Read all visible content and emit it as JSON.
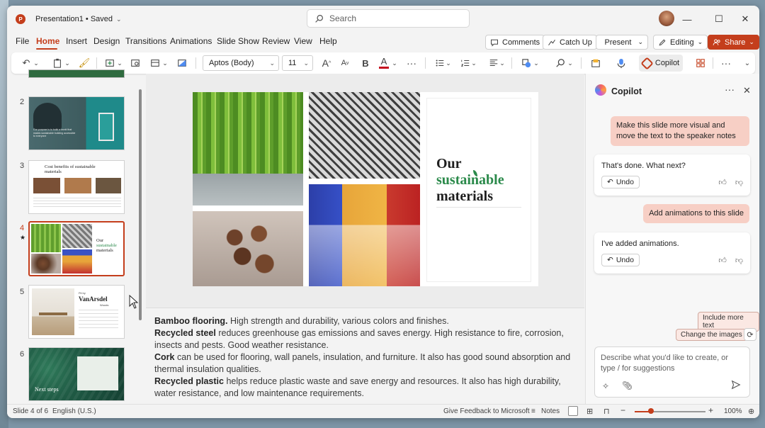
{
  "titlebar": {
    "doc_title": "Presentation1 • Saved",
    "search_placeholder": "Search"
  },
  "menu": {
    "items": [
      "File",
      "Home",
      "Insert",
      "Design",
      "Transitions",
      "Animations",
      "Slide Show",
      "Review",
      "View",
      "Help"
    ],
    "active": "Home"
  },
  "ribbon_actions": {
    "comments": "Comments",
    "catch_up": "Catch Up",
    "present": "Present",
    "editing": "Editing",
    "share": "Share"
  },
  "ribbon": {
    "font_name": "Aptos (Body)",
    "font_size": "11",
    "copilot_label": "Copilot",
    "bold_glyph": "B",
    "font_color_glyph": "A",
    "font_color": "#c50f1f",
    "grow_glyph": "A",
    "shrink_glyph": "A"
  },
  "thumbnails": {
    "numbers": [
      "2",
      "3",
      "4",
      "5",
      "6"
    ],
    "slide2_text": "Our purpose is to build a world that makes sustainable building accessible to everyone",
    "slide3_title": "Cost benefits of sustainable materials",
    "slide4_line1": "Our",
    "slide4_line2": "sustainable",
    "slide4_line3": "materials",
    "slide5_title_small": "Fit by",
    "slide5_title": "VanArsdel",
    "slide5_sub": "Woods",
    "slide6_title": "Next steps"
  },
  "slide": {
    "title_line1": "Our",
    "title_line2": "sustainable",
    "title_line3": "materials",
    "accent_color": "#2b8a4b"
  },
  "notes": {
    "p1_bold": "Bamboo flooring.",
    "p1_text": " High strength and durability, various colors and finishes.",
    "p2_bold": "Recycled steel",
    "p2_text": " reduces greenhouse gas emissions and saves energy. High resistance to fire, corrosion, insects and pests. Good weather resistance.",
    "p3_bold": "Cork",
    "p3_text": " can be used for flooring, wall panels, insulation, and furniture. It also has good sound absorption and thermal insulation qualities.",
    "p4_bold": "Recycled plastic",
    "p4_text": " helps reduce plastic waste and save energy and resources. It also has high durability, water resistance, and low maintenance requirements."
  },
  "copilot": {
    "title": "Copilot",
    "messages": [
      {
        "role": "user",
        "text": "Make this slide more visual and move the text to the speaker notes"
      },
      {
        "role": "assistant",
        "text": "That's done. What next?"
      },
      {
        "role": "user",
        "text": "Add animations to this slide"
      },
      {
        "role": "assistant",
        "text": "I've added animations."
      }
    ],
    "undo_label": "Undo",
    "suggestions": [
      "Include more text",
      "Change the images"
    ],
    "input_placeholder": "Describe what you'd like to create, or type / for suggestions"
  },
  "status": {
    "slide_info": "Slide 4 of 6",
    "language": "English (U.S.)",
    "feedback": "Give Feedback to Microsoft",
    "notes": "Notes",
    "zoom": "100%"
  }
}
